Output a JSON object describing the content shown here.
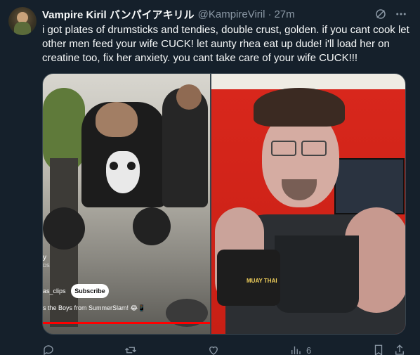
{
  "author": {
    "display_name": "Vampire Kiril バンパイアキリル",
    "handle": "@KampireViril",
    "separator": "·",
    "time": "27m"
  },
  "tweet": {
    "text": "i got plates of drumsticks and tendies, double crust, golden. if you cant cook let other men feed your wife CUCK! let aunty rhea eat up dude! i'll load her on creatine too, fix her anxiety. you cant take care of your wife CUCK!!!"
  },
  "media": {
    "left_video": {
      "channel_fragment": "y",
      "channel_sub_fragment": "DS",
      "channel_name": "as_clips",
      "subscribe_label": "Subscribe",
      "caption": "s the Boys from SummerSlam! 😂📱",
      "progress": 1.0
    },
    "right_image": {
      "wrap_text": "MUAY THAI"
    }
  },
  "actions": {
    "reply_count": "",
    "retweet_count": "",
    "like_count": "",
    "views_count": "6"
  },
  "icons": [
    "grok-icon",
    "more-icon",
    "reply-icon",
    "retweet-icon",
    "like-icon",
    "views-icon",
    "bookmark-icon",
    "share-icon"
  ],
  "colors": {
    "background": "#15202b",
    "text_primary": "#f7f9f9",
    "text_secondary": "#8b98a5",
    "progress_red": "#ff0000"
  }
}
